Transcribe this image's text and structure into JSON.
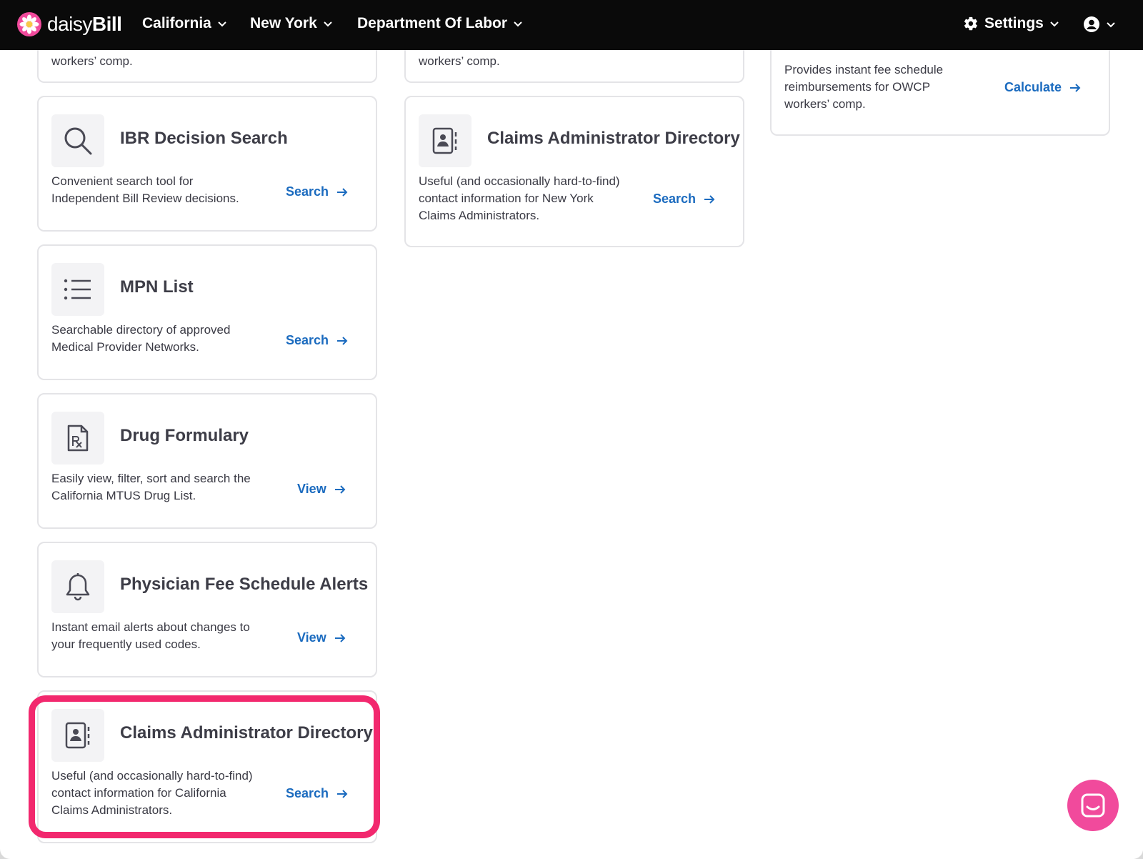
{
  "app": {
    "logo_text_light": "daisy",
    "logo_text_bold": "Bill"
  },
  "nav": {
    "items": [
      {
        "label": "California"
      },
      {
        "label": "New York"
      },
      {
        "label": "Department Of Labor"
      }
    ],
    "settings_label": "Settings"
  },
  "colors": {
    "topbar": "#0a0a0a",
    "link": "#1b6bbf",
    "highlight": "#f2286e",
    "chat": "#f14a9c"
  },
  "columns": {
    "col1": {
      "partial_card": {
        "desc_tail": "workers’ comp."
      },
      "cards": [
        {
          "icon": "search-icon",
          "title": "IBR Decision Search",
          "desc": [
            "Convenient search tool for",
            "Independent Bill Review decisions."
          ],
          "link": "Search"
        },
        {
          "icon": "list-icon",
          "title": "MPN List",
          "desc": [
            "Searchable directory of approved",
            "Medical Provider Networks."
          ],
          "link": "Search"
        },
        {
          "icon": "prescription-file-icon",
          "title": "Drug Formulary",
          "desc": [
            "Easily view, filter, sort and search the",
            "California MTUS Drug List."
          ],
          "link": "View"
        },
        {
          "icon": "bell-icon",
          "title": "Physician Fee Schedule Alerts",
          "desc": [
            "Instant email alerts about changes to",
            "your frequently used codes."
          ],
          "link": "View"
        },
        {
          "icon": "contact-book-icon",
          "title": "Claims Administrator Directory",
          "desc": [
            "Useful (and occasionally hard-to-find)",
            "contact information for California",
            "Claims Administrators."
          ],
          "link": "Search"
        }
      ]
    },
    "col2": {
      "partial_card": {
        "desc_tail": "workers’ comp."
      },
      "cards": [
        {
          "icon": "contact-book-icon",
          "title": "Claims Administrator Directory",
          "desc": [
            "Useful (and occasionally hard-to-find)",
            "contact information for New York",
            "Claims Administrators."
          ],
          "link": "Search"
        }
      ]
    },
    "col3": {
      "partial_card": {
        "desc": [
          "Provides instant fee schedule",
          "reimbursements for OWCP",
          "workers’ comp."
        ],
        "link": "Calculate"
      }
    }
  }
}
